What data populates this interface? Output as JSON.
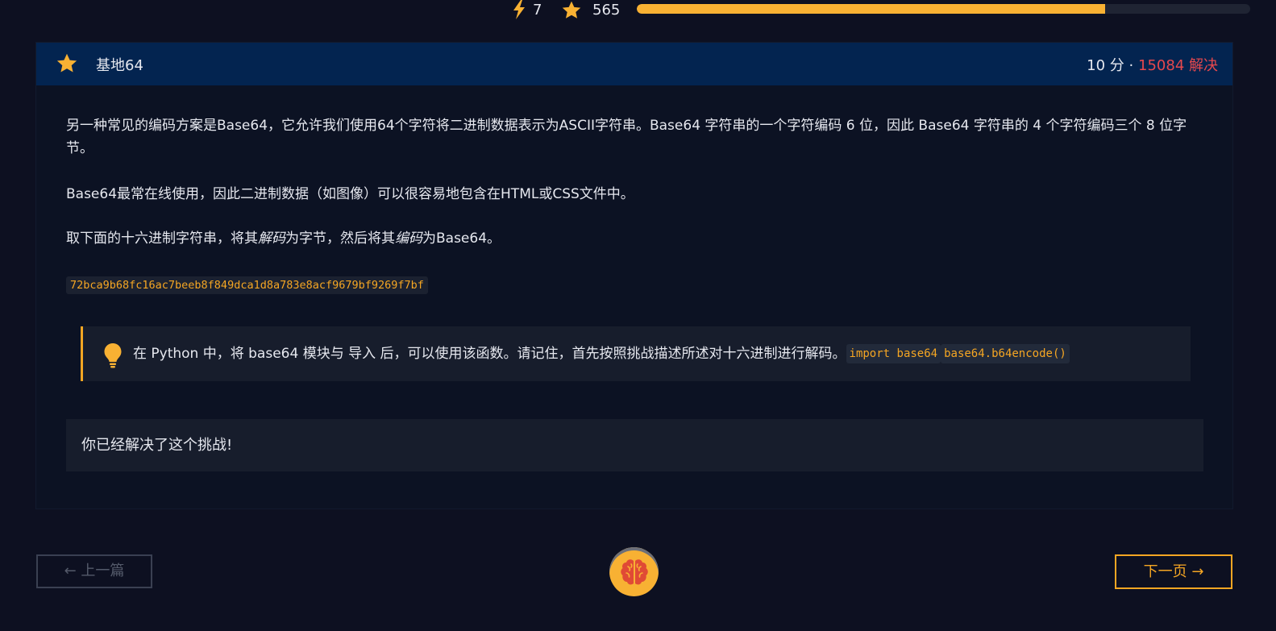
{
  "topbar": {
    "bolt_icon": "lightning-bolt-icon",
    "bolt_count": "7",
    "star_icon": "star-icon",
    "star_count": "565",
    "progress_fraction": 0.764,
    "progress_color": "#f8b133"
  },
  "challenge": {
    "title": "基地64",
    "points": "10 分",
    "separator": "·",
    "solves": "15084 解决",
    "paragraph1": "另一种常见的编码方案是Base64，它允许我们使用64个字符将二进制数据表示为ASCII字符串。Base64 字符串的一个字符编码 6 位，因此 Base64 字符串的 4 个字符编码三个 8 位字节。",
    "paragraph2": "Base64最常在线使用，因此二进制数据（如图像）可以很容易地包含在HTML或CSS文件中。",
    "paragraph3_before_decode": "取下面的十六进制字符串，将其",
    "paragraph3_decode": "解码",
    "paragraph3_middle": "为字节，然后将其",
    "paragraph3_encode": "编码",
    "paragraph3_after": "为Base64。",
    "hex_string": "72bca9b68fc16ac7beeb8f849dca1d8a783e8acf9679bf9269f7bf",
    "hint_text": "在 Python 中，将 base64 模块与 导入 后，可以使用该函数。请记住，首先按照挑战描述所述对十六进制进行解码。",
    "hint_code1": "import base64",
    "hint_code2": "base64.b64encode()",
    "solved_message": "你已经解决了这个挑战!"
  },
  "nav": {
    "prev_label": "← 上一篇",
    "next_label": "下一页 →",
    "brain_icon": "brain-icon"
  },
  "colors": {
    "accent": "#f5a623",
    "solves_red": "#e5484d",
    "header_bg": "#032450"
  }
}
